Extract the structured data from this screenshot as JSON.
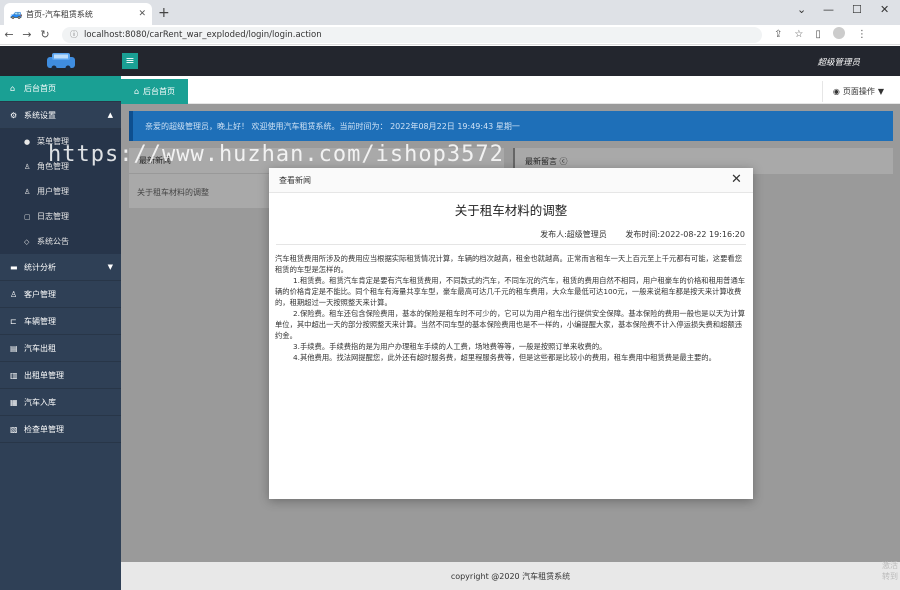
{
  "browser": {
    "tab_title": "首页-汽车租赁系统",
    "url": "localhost:8080/carRent_war_exploded/login/login.action"
  },
  "header": {
    "admin_name": "超级管理员"
  },
  "sidebar": {
    "items": [
      {
        "label": "后台首页"
      },
      {
        "label": "系统设置"
      },
      {
        "label": "统计分析"
      },
      {
        "label": "客户管理"
      },
      {
        "label": "车辆管理"
      },
      {
        "label": "汽车出租"
      },
      {
        "label": "出租单管理"
      },
      {
        "label": "汽车入库"
      },
      {
        "label": "检查单管理"
      }
    ],
    "sub_items": [
      {
        "label": "菜单管理"
      },
      {
        "label": "角色管理"
      },
      {
        "label": "用户管理"
      },
      {
        "label": "日志管理"
      },
      {
        "label": "系统公告"
      }
    ]
  },
  "tabs": {
    "home": "后台首页",
    "page_ops": "页面操作"
  },
  "content": {
    "welcome": "亲爱的超级管理员，晚上好！ 欢迎使用汽车租赁系统。当前时间为： 2022年08月22日 19:49:43   星期一",
    "news_header": "最新新闻",
    "news_item": "关于租车材料的调整",
    "msg_header": "最新留言 ⓒ",
    "watermark": "https://www.huzhan.com/ishop3572"
  },
  "modal": {
    "header": "查看新闻",
    "title": "关于租车材料的调整",
    "publisher": "发布人:超级管理员",
    "publish_time": "发布时间:2022-08-22 19:16:20",
    "paragraphs": [
      "汽车租赁费用所涉及的费用应当根据实际租赁情况计算，车辆的档次越高，租金也就越高。正常而言租车一天上百元至上千元都有可能，这要看您租赁的车型是怎样的。",
      "1.租赁费。租赁汽车肯定是要有汽车租赁费用，不同款式的汽车，不同车况的汽车，租赁的费用自然不相同，用户租豪车的价格和租用普通车辆的价格肯定是不能比。同个租车有海量共享车型，豪车最高可达几千元的租车费用，大众车最低可达100元，一般来说租车都是按天来计算收费的，租期超过一天按照整天来计算。",
      "2.保险费。租车还包含保险费用，基本的保险是租车时不可少的，它可以为用户租车出行提供安全保障。基本保险的费用一般也是以天为计算单位，其中超出一天的部分按照整天来计算。当然不同车型的基本保险费用也是不一样的，小编提醒大家，基本保险费不计入停运损失费和超额违约金。",
      "3.手续费。手续费指的是为用户办理租车手续的人工费，场地费等等，一般是按照订单来收费的。",
      "4.其他费用。找法网提醒您，此外还有超时服务费，超里程服务费等，但是这些都是比较小的费用，租车费用中租赁费是最主要的。"
    ]
  },
  "footer": {
    "copyright": "copyright @2020 汽车租赁系统"
  },
  "corner_mark": "激活\n转到"
}
